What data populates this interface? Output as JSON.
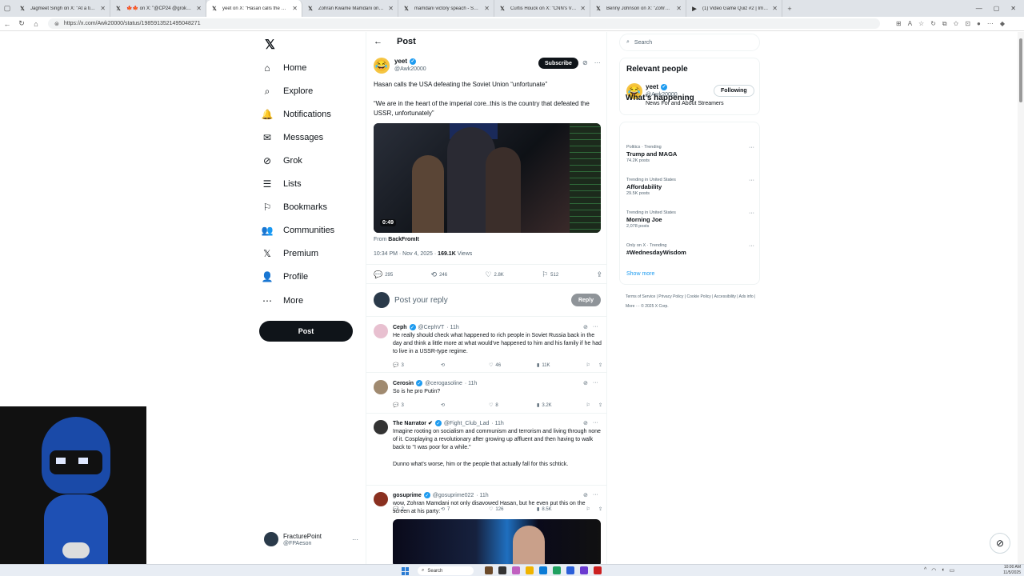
{
  "browser": {
    "tabs": [
      {
        "icon": "x-logo-icon",
        "title": "Jagmeet Singh on X: \"At a time w...",
        "active": false
      },
      {
        "icon": "x-logo-icon",
        "title": "🍁🍁 on X: \"@CP24 @grok H...",
        "active": false
      },
      {
        "icon": "x-logo-icon",
        "title": "yeet on X: \"Hasan calls the USA d...",
        "active": true
      },
      {
        "icon": "x-logo-icon",
        "title": "Zohran Kwame Mamdani on X: \"T...",
        "active": false
      },
      {
        "icon": "x-logo-icon",
        "title": "mamdani victory speach - Search",
        "active": false
      },
      {
        "icon": "x-logo-icon",
        "title": "Curtis Houck on X: \"CNN's Van Jo...",
        "active": false
      },
      {
        "icon": "x-logo-icon",
        "title": "Benny Johnson on X: \"Zohran Ma...",
        "active": false
      },
      {
        "icon": "youtube-icon",
        "title": "(1) Video Game Quiz #2 | Images...",
        "active": false
      }
    ],
    "url": "https://x.com/Awk20000/status/1985913521495048271"
  },
  "sidenav": {
    "items": [
      {
        "icon": "home-icon",
        "glyph": "⌂",
        "label": "Home"
      },
      {
        "icon": "search-icon",
        "glyph": "⌕",
        "label": "Explore"
      },
      {
        "icon": "bell-icon",
        "glyph": "🔔",
        "label": "Notifications"
      },
      {
        "icon": "mail-icon",
        "glyph": "✉",
        "label": "Messages"
      },
      {
        "icon": "grok-icon",
        "glyph": "⊘",
        "label": "Grok"
      },
      {
        "icon": "list-icon",
        "glyph": "☰",
        "label": "Lists"
      },
      {
        "icon": "bookmark-icon",
        "glyph": "⚐",
        "label": "Bookmarks"
      },
      {
        "icon": "communities-icon",
        "glyph": "👥",
        "label": "Communities"
      },
      {
        "icon": "x-premium-icon",
        "glyph": "𝕏",
        "label": "Premium"
      },
      {
        "icon": "profile-icon",
        "glyph": "👤",
        "label": "Profile"
      },
      {
        "icon": "more-icon",
        "glyph": "⋯",
        "label": "More"
      }
    ],
    "post_label": "Post",
    "account": {
      "name": "FracturePoint",
      "handle": "@FPAeson"
    }
  },
  "main": {
    "header_title": "Post",
    "author": {
      "name": "yeet",
      "handle": "@Awk20000"
    },
    "subscribe_label": "Subscribe",
    "text1": "Hasan calls the USA defeating the Soviet Union “unfortunate”",
    "text2": "“We are in the heart of the imperial core..this is the country that defeated the USSR, unfortunately”",
    "video_duration": "0:49",
    "from_prefix": "From",
    "from_name": "BackFromIt",
    "timestamp": "10:34 PM · Nov 4, 2025 ·",
    "views": "169.1K",
    "views_label": "Views",
    "stats": {
      "replies": "295",
      "reposts": "246",
      "likes": "2.8K",
      "bookmarks": "512"
    },
    "reply_placeholder": "Post your reply",
    "reply_button": "Reply"
  },
  "replies": [
    {
      "name": "Ceph",
      "handle": "@CephVT",
      "time": "· 11h",
      "text": "He really should check what happened to rich people in Soviet Russia back in the day and think a little more at what would've happened to him and his family if he had to live in a USSR-type regime.",
      "replies": "3",
      "reposts": "",
      "likes": "46",
      "views": "11K",
      "avatar_color": "#e8c0d0"
    },
    {
      "name": "Cerosin",
      "handle": "@cerogasoline",
      "time": "· 11h",
      "text": "So is he pro Putin?",
      "replies": "3",
      "reposts": "",
      "likes": "8",
      "views": "3.2K",
      "avatar_color": "#a08a70"
    },
    {
      "name": "The Narrator ✔",
      "handle": "@Fight_Club_Lad",
      "time": "· 11h",
      "text": "Imagine rooting on socialism and communism and terrorism and living through none of it. Cosplaying a revolutionary after growing up affluent and then having to walk back to \"I was poor for a while.\"",
      "text2": "Dunno what's worse, him or the people that actually fall for this schtick.",
      "replies": "2",
      "reposts": "7",
      "likes": "126",
      "views": "8.5K",
      "avatar_color": "#333"
    },
    {
      "name": "gosuprime",
      "handle": "@gosuprime022",
      "time": "· 11h",
      "text": "wow, Zohran Mamdani not only disavowed Hasan, but he even put this on the screen at his party:",
      "avatar_color": "#8a3020"
    }
  ],
  "right": {
    "search_placeholder": "Search",
    "relevant_title": "Relevant people",
    "relevant": {
      "name": "yeet",
      "handle": "@Awk20000",
      "bio": "News For and About Streamers",
      "follow_label": "Following"
    },
    "happening_title": "What’s happening",
    "trends": [
      {
        "context": "Politics · Trending",
        "name": "Trump and MAGA",
        "posts": "74.2K posts"
      },
      {
        "context": "Trending in United States",
        "name": "Affordability",
        "posts": "29.5K posts"
      },
      {
        "context": "Trending in United States",
        "name": "Morning Joe",
        "posts": "2,078 posts"
      },
      {
        "context": "Only on X · Trending",
        "name": "#WednesdayWisdom",
        "posts": ""
      }
    ],
    "show_more": "Show more",
    "footer": "Terms of Service  |  Privacy Policy  |  Cookie Policy  |  Accessibility  |  Ads info  |  More ···  © 2025 X Corp."
  },
  "taskbar": {
    "search_label": "Search",
    "time": "10:00 AM",
    "date": "11/5/2025"
  }
}
